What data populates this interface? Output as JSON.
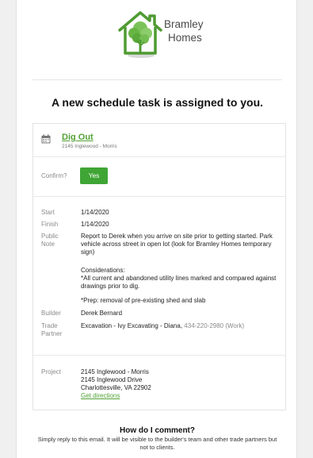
{
  "brand": {
    "line1": "Bramley",
    "line2": "Homes",
    "green": "#52a235",
    "logo_icon": "house-tree-logo"
  },
  "headline": "A new schedule task is assigned to you.",
  "task": {
    "title": "Dig Out",
    "address": "2145 Inglewood - Morris",
    "icon": "calendar-icon"
  },
  "confirm": {
    "label": "Confirm?",
    "button": "Yes",
    "button_color": "#3fa535"
  },
  "details": {
    "start_label": "Start",
    "start_value": "1/14/2020",
    "finish_label": "Finish",
    "finish_value": "1/14/2020",
    "note_label_1": "Public",
    "note_label_2": "Note",
    "note_p1": "Report to Derek when you arrive on site prior to getting started. Park vehicle across street in open lot (look for Bramley Homes temporary sign)",
    "note_p2": "Considerations:",
    "note_p3": "*All current and abandoned utility lines marked and compared against drawings prior to dig.",
    "note_p4": "*Prep: removal of pre-existing shed and slab",
    "builder_label": "Builder",
    "builder_value": "Derek Bernard",
    "trade_label_1": "Trade",
    "trade_label_2": "Partner",
    "trade_value": "Excavation - Ivy Excavating - Diana,",
    "trade_phone": "434-220-2980 (Work)"
  },
  "project": {
    "label": "Project",
    "line1": "2145 Inglewood - Morris",
    "line2": "2145 Inglewood Drive",
    "line3": "Charlottesville, VA 22902",
    "directions": "Get directions"
  },
  "footer": {
    "title": "How do I comment?",
    "text": "Simply reply to this email. It will be visible to the builder's team and other trade partners but not to clients."
  }
}
